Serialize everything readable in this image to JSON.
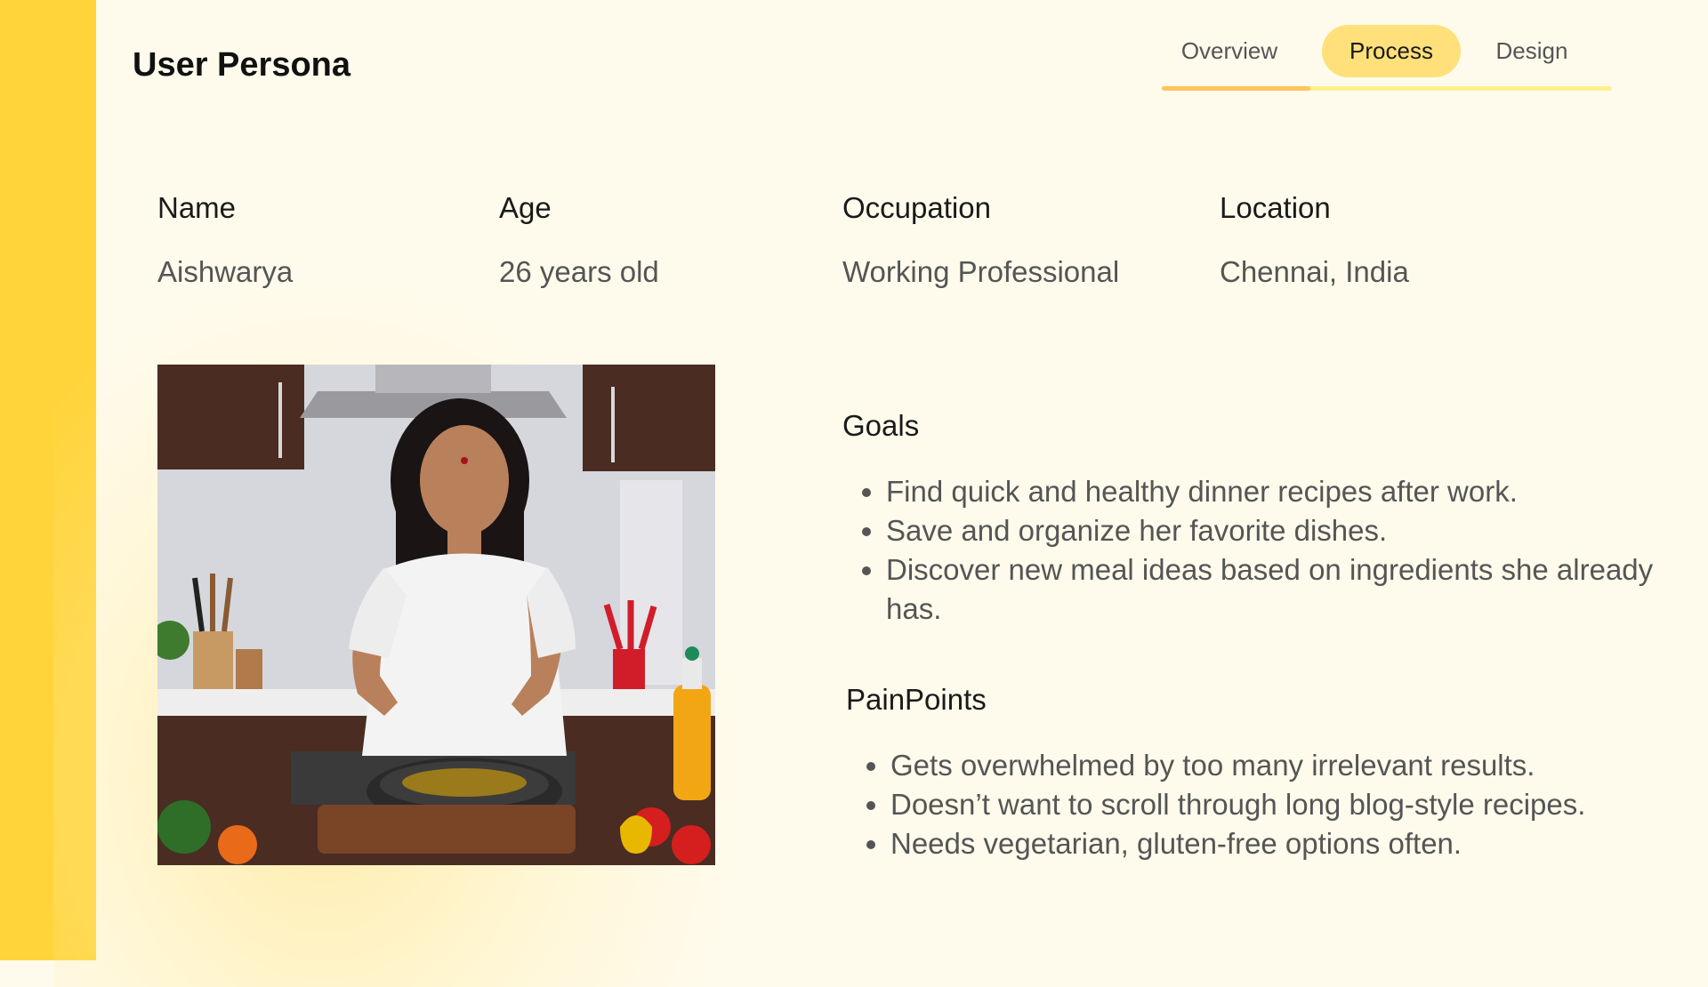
{
  "header": {
    "title": "User Persona"
  },
  "tabs": [
    {
      "label": "Overview",
      "active": false
    },
    {
      "label": "Process",
      "active": true
    },
    {
      "label": "Design",
      "active": false
    }
  ],
  "persona": {
    "name": {
      "label": "Name",
      "value": "Aishwarya"
    },
    "age": {
      "label": "Age",
      "value": "26 years old"
    },
    "occupation": {
      "label": "Occupation",
      "value": "Working Professional"
    },
    "location": {
      "label": "Location",
      "value": "Chennai, India"
    }
  },
  "goals": {
    "title": "Goals",
    "items": [
      "Find quick and healthy dinner recipes after work.",
      "Save and organize her favorite dishes.",
      "Discover new meal ideas based on ingredients she already has."
    ]
  },
  "painpoints": {
    "title": "PainPoints",
    "items": [
      "Gets overwhelmed by too many irrelevant results.",
      "Doesn’t want to scroll through long blog-style recipes.",
      "Needs vegetarian, gluten-free options often."
    ]
  },
  "colors": {
    "sidebar": "#ffd43b",
    "background": "#fffbec",
    "active_tab": "#ffe07a",
    "tab_indicator": "#ffc45a"
  },
  "image": {
    "icon": "persona-photo-cooking"
  }
}
